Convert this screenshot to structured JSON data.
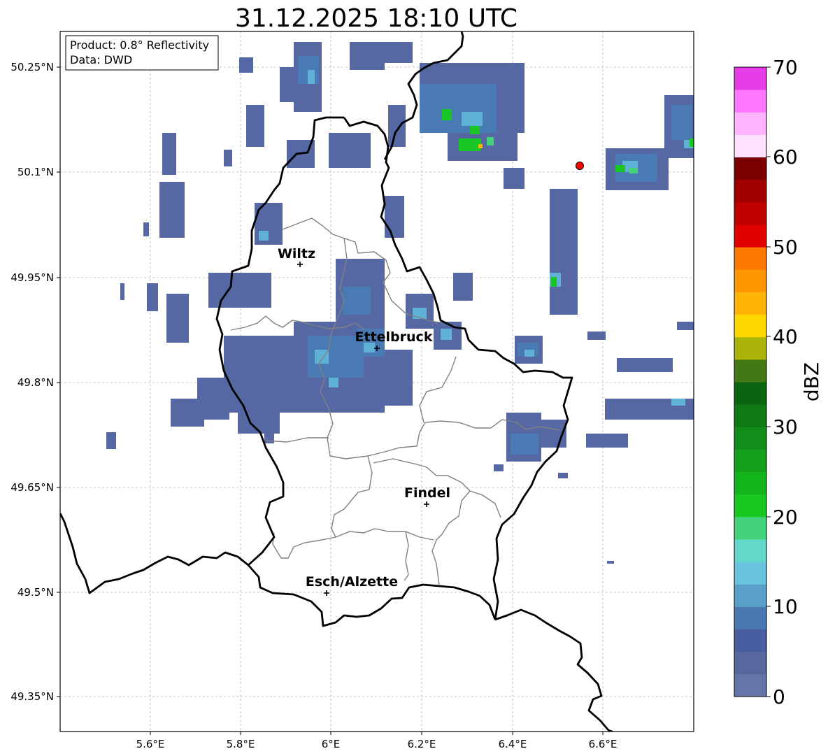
{
  "title": "31.12.2025 18:10 UTC",
  "info_box": {
    "line1": "Product: 0.8° Reflectivity",
    "line2": "Data: DWD"
  },
  "x_ticks": [
    "5.6°E",
    "5.8°E",
    "6°E",
    "6.2°E",
    "6.4°E",
    "6.6°E"
  ],
  "y_ticks": [
    "50.25°N",
    "50.1°N",
    "49.95°N",
    "49.8°N",
    "49.65°N",
    "49.5°N",
    "49.35°N"
  ],
  "colorbar": {
    "label": "dBZ",
    "ticks": [
      "0",
      "10",
      "20",
      "30",
      "40",
      "50",
      "60",
      "70"
    ],
    "colors": [
      "#6475a8",
      "#58689e",
      "#485ea0",
      "#4a78b0",
      "#58a0c8",
      "#68c3dc",
      "#64d8c8",
      "#44d27a",
      "#18c820",
      "#14b41c",
      "#14a01c",
      "#128c1a",
      "#107814",
      "#0a6410",
      "#447814",
      "#aab408",
      "#ffd800",
      "#ffb408",
      "#ff9800",
      "#ff7800",
      "#e00000",
      "#c00000",
      "#a00000",
      "#7c0000",
      "#ffe0ff",
      "#ffb4ff",
      "#ff78ff",
      "#e83ce8"
    ]
  },
  "cities": [
    {
      "name": "Wiltz"
    },
    {
      "name": "Ettelbruck"
    },
    {
      "name": "Findel"
    },
    {
      "name": "Esch/Alzette"
    }
  ],
  "colors": {
    "border": "#000000",
    "admin": "#808080",
    "radar_marker": "#ff0000",
    "grid": "#b4b4b4"
  }
}
